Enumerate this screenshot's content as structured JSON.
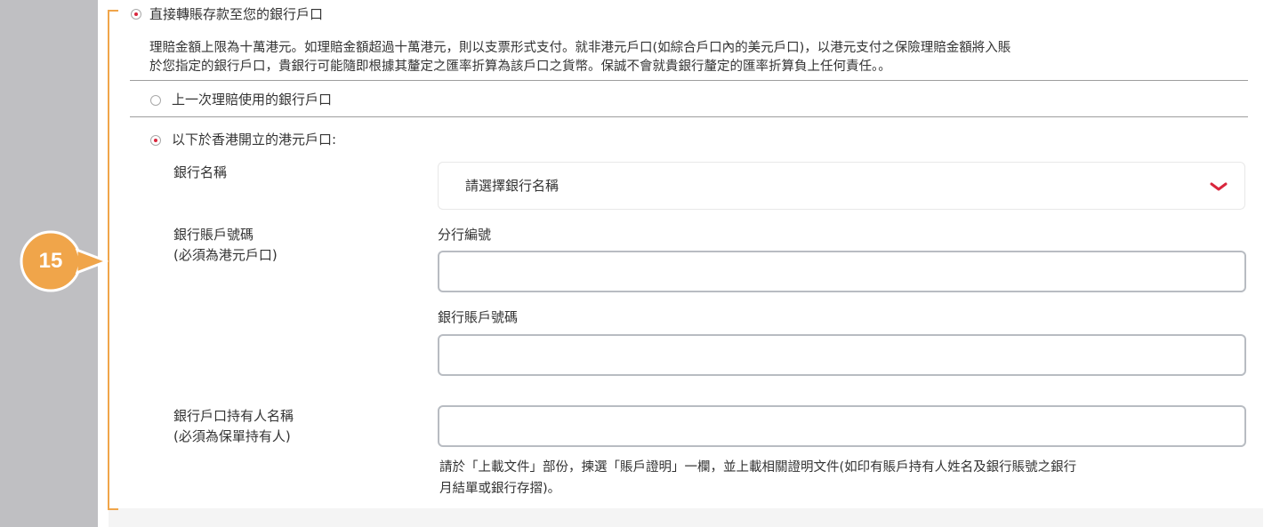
{
  "callout": {
    "number": "15"
  },
  "option_direct": {
    "label": "直接轉賬存款至您的銀行戶口",
    "selected": true,
    "note_line1": "理賠金額上限為十萬港元。如理賠金額超過十萬港元，則以支票形式支付。就非港元戶口(如綜合戶口內的美元戶口)，以港元支付之保險理賠金額將入賬",
    "note_line2": "於您指定的銀行戶口，貴銀行可能隨即根據其釐定之匯率折算為該戶口之貨幣。保誠不會就貴銀行釐定的匯率折算負上任何責任。。"
  },
  "option_last": {
    "label": "上一次理賠使用的銀行戶口",
    "selected": false
  },
  "option_hk": {
    "label": "以下於香港開立的港元戶口:",
    "selected": true
  },
  "bank_name": {
    "label": "銀行名稱",
    "placeholder": "請選擇銀行名稱",
    "icon": "chevron-down-icon"
  },
  "account_number": {
    "label_line1": "銀行賬戶號碼",
    "label_line2": "(必須為港元戶口)",
    "branch_label": "分行編號",
    "branch_value": "",
    "account_label": "銀行賬戶號碼",
    "account_value": ""
  },
  "holder": {
    "label_line1": "銀行戶口持有人名稱",
    "label_line2": "(必須為保單持有人)",
    "value": "",
    "note_line1": "請於「上載文件」部份，揀選「賬戶證明」一欄，並上載相關證明文件(如印有賬戶持有人姓名及銀行賬號之銀行",
    "note_line2": "月結單或銀行存摺)。"
  },
  "colors": {
    "accent_red": "#d9263d",
    "callout_orange": "#f0a54a",
    "side_strip": "#bfbfc2"
  }
}
